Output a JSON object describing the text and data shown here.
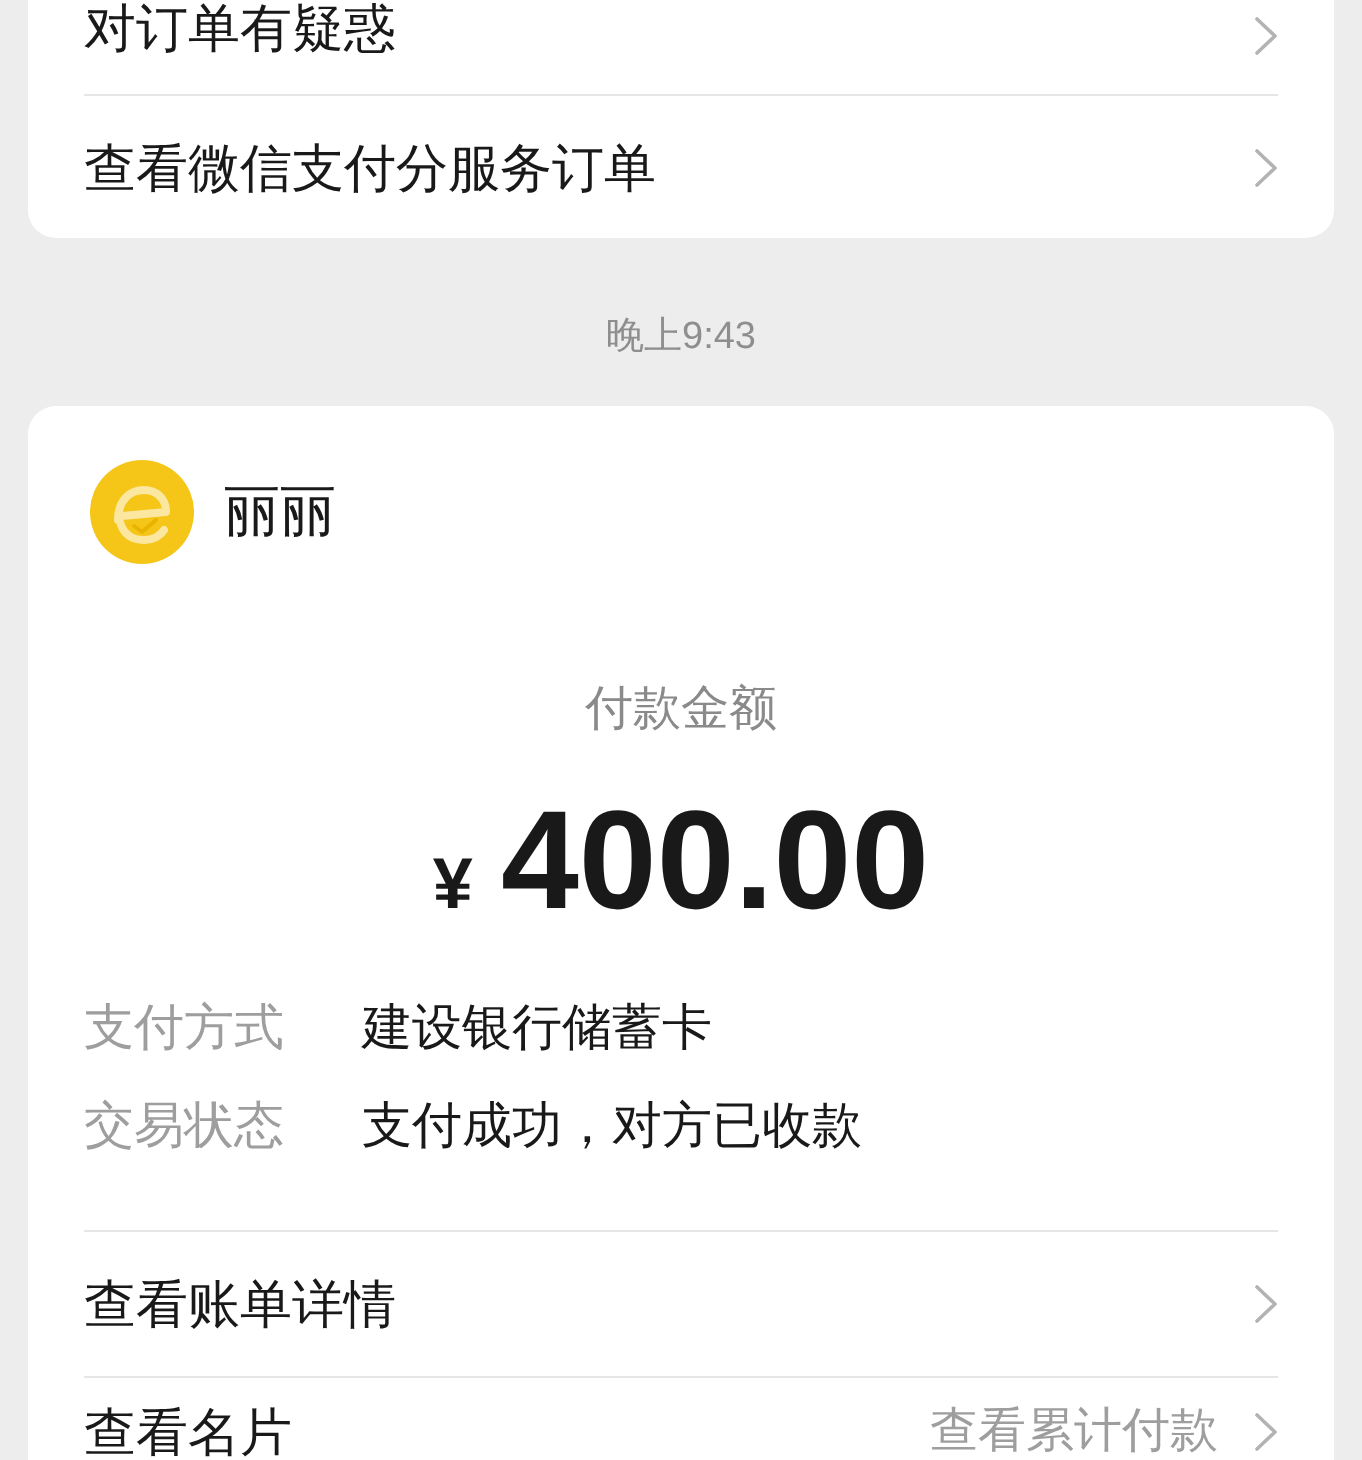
{
  "order_menu": {
    "items": [
      {
        "label": "对订单有疑惑"
      },
      {
        "label": "查看微信支付分服务订单"
      }
    ]
  },
  "timestamp": "晚上9:43",
  "payment_card": {
    "payee": {
      "name": "丽丽"
    },
    "amount_label": "付款金额",
    "currency": "¥",
    "amount": "400.00",
    "details": [
      {
        "label": "支付方式",
        "value": "建设银行储蓄卡"
      },
      {
        "label": "交易状态",
        "value": "支付成功，对方已收款"
      }
    ],
    "actions": [
      {
        "label": "查看账单详情"
      },
      {
        "label": "查看名片",
        "trailing": "查看累计付款"
      }
    ]
  }
}
